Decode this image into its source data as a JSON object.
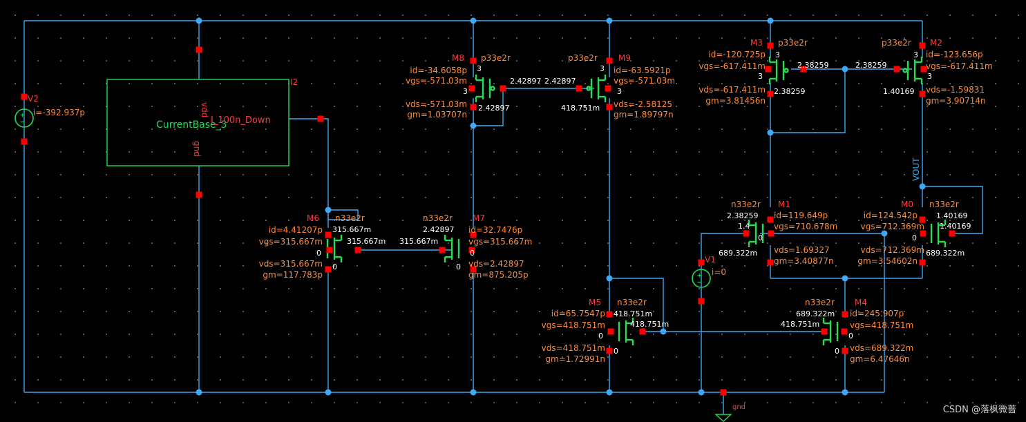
{
  "schematic": {
    "V2": {
      "name": "V2",
      "i": "i=-392.937p"
    },
    "V1": {
      "name": "V1",
      "i": "i=0"
    },
    "I2": {
      "name": "I2",
      "cell": "CurrentBase_3",
      "out_pin": "I_100n_Down",
      "vdd_pin": "vdd",
      "gnd_pin": "gnd"
    },
    "M8": {
      "name": "M8",
      "model": "p33e2r",
      "id": "id=-34.6058p",
      "vgs": "vgs=-571.03m",
      "vds": "vds=-571.03m",
      "gm": "gm=1.03707n",
      "t_a": "3",
      "t_b": "3",
      "g": "2.42897",
      "d": "2.42897"
    },
    "M9": {
      "name": "M9",
      "model": "p33e2r",
      "id": "id=-63.5921p",
      "vgs": "vgs=-571.03m",
      "vds": "vds=-2.58125",
      "gm": "gm=1.89797n",
      "t_a": "3",
      "t_b": "3",
      "g": "2.42897",
      "d": "418.751m"
    },
    "M3": {
      "name": "M3",
      "model": "p33e2r",
      "id": "id=-120.725p",
      "vgs": "vgs=-617.411m",
      "vds": "vds=-617.411m",
      "gm": "gm=3.81456n",
      "t_a": "3",
      "t_b": "3",
      "g": "2.38259",
      "d": "2.38259"
    },
    "M2": {
      "name": "M2",
      "model": "p33e2r",
      "id": "id=-123.656p",
      "vgs": "vgs=-617.411m",
      "vds": "vds=-1.59831",
      "gm": "gm=3.90714n",
      "t_a": "3",
      "t_b": "3",
      "g": "2.38259",
      "d": "1.40169"
    },
    "M6": {
      "name": "M6",
      "model": "n33e2r",
      "id": "id=4.41207p",
      "vgs": "vgs=315.667m",
      "vds": "vds=315.667m",
      "gm": "gm=117.783p",
      "d": "315.667m",
      "g": "315.667m",
      "t_a": "0",
      "t_b": "0"
    },
    "M7": {
      "name": "M7",
      "model": "n33e2r",
      "id": "id=32.7476p",
      "vgs": "vgs=315.667m",
      "vds": "vds=2.42897",
      "gm": "gm=875.205p",
      "d": "2.42897",
      "g": "315.667m",
      "t_a": "0",
      "t_b": "0"
    },
    "M1": {
      "name": "M1",
      "model": "n33e2r",
      "id": "id=119.649p",
      "vgs": "vgs=710.678m",
      "vds": "vds=1.69327",
      "gm": "gm=3.40877n",
      "d": "2.38259",
      "g": "1.4",
      "s": "689.322m",
      "t_a": "0"
    },
    "M0": {
      "name": "M0",
      "model": "n33e2r",
      "id": "id=124.542p",
      "vgs": "vgs=712.369m",
      "vds": "vds=712.369m",
      "gm": "gm=3.54602n",
      "d": "1.40169",
      "g": "1.40169",
      "s": "689.322m",
      "t_a": "0"
    },
    "M5": {
      "name": "M5",
      "model": "n33e2r",
      "id": "id=65.7547p",
      "vgs": "vgs=418.751m",
      "vds": "vds=418.751m",
      "gm": "gm=1.72991n",
      "d": "418.751m",
      "g": "418.751m",
      "t_a": "0",
      "t_b": "0"
    },
    "M4": {
      "name": "M4",
      "model": "n33e2r",
      "id": "id=245.907p",
      "vgs": "vgs=418.751m",
      "vds": "vds=689.322m",
      "gm": "gm=6.47646n",
      "d": "689.322m",
      "g": "418.751m",
      "t_a": "0",
      "t_b": "0"
    },
    "vout_label": "VOUT",
    "gnd_label": "gnd"
  },
  "watermark": "CSDN @落枫微蔷",
  "colors": {
    "background": "#000000",
    "wire": "#3fa9f5",
    "device": "#22dd55",
    "pin": "#ff0000",
    "annotation": "#ff8c3a",
    "inst_name": "#ff3a3a",
    "gnd_symbol": "#22dd55",
    "grid_dot": "#bfbfbf"
  }
}
